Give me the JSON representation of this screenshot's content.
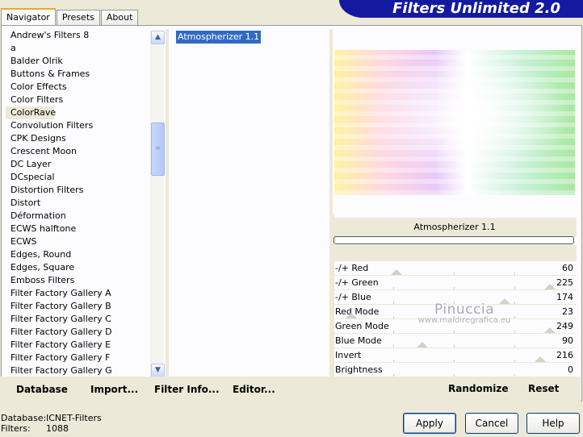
{
  "app": {
    "title": "Filters Unlimited 2.0"
  },
  "tabs": [
    {
      "label": "Navigator"
    },
    {
      "label": "Presets"
    },
    {
      "label": "About"
    }
  ],
  "categories": [
    "Andrew's Filters 8",
    "a",
    "Balder Olrik",
    "Buttons & Frames",
    "Color Effects",
    "Color Filters",
    "ColorRave",
    "Convolution Filters",
    "CPK Designs",
    "Crescent Moon",
    "DC Layer",
    "DCspecial",
    "Distortion Filters",
    "Distort",
    "Déformation",
    "ECWS halftone",
    "ECWS",
    "Edges, Round",
    "Edges, Square",
    "Emboss Filters",
    "Filter Factory Gallery A",
    "Filter Factory Gallery B",
    "Filter Factory Gallery C",
    "Filter Factory Gallery D",
    "Filter Factory Gallery E",
    "Filter Factory Gallery F",
    "Filter Factory Gallery G"
  ],
  "selected_category": "ColorRave",
  "filters": [
    "Atmospherizer 1.1"
  ],
  "selected_filter": "Atmospherizer 1.1",
  "preview": {
    "filter_name": "Atmospherizer 1.1"
  },
  "sliders": [
    {
      "label": "-/+ Red",
      "value": 60
    },
    {
      "label": "-/+ Green",
      "value": 225
    },
    {
      "label": "-/+ Blue",
      "value": 174
    },
    {
      "label": "Red Mode",
      "value": 23
    },
    {
      "label": "Green Mode",
      "value": 249
    },
    {
      "label": "Blue Mode",
      "value": 90
    },
    {
      "label": "Invert",
      "value": 216
    },
    {
      "label": "Brightness",
      "value": 0
    }
  ],
  "watermark": {
    "line1": "Pinuccia",
    "line2": "www.maidiregrafica.eu"
  },
  "left_buttons": {
    "database": "Database",
    "import": "Import...",
    "filter_info": "Filter Info...",
    "editor": "Editor..."
  },
  "right_buttons": {
    "randomize": "Randomize",
    "reset": "Reset"
  },
  "status": {
    "database_label": "Database:",
    "database_value": "ICNET-Filters",
    "filters_label": "Filters:",
    "filters_value": "1088"
  },
  "dialog_buttons": {
    "apply": "Apply",
    "cancel": "Cancel",
    "help": "Help"
  }
}
